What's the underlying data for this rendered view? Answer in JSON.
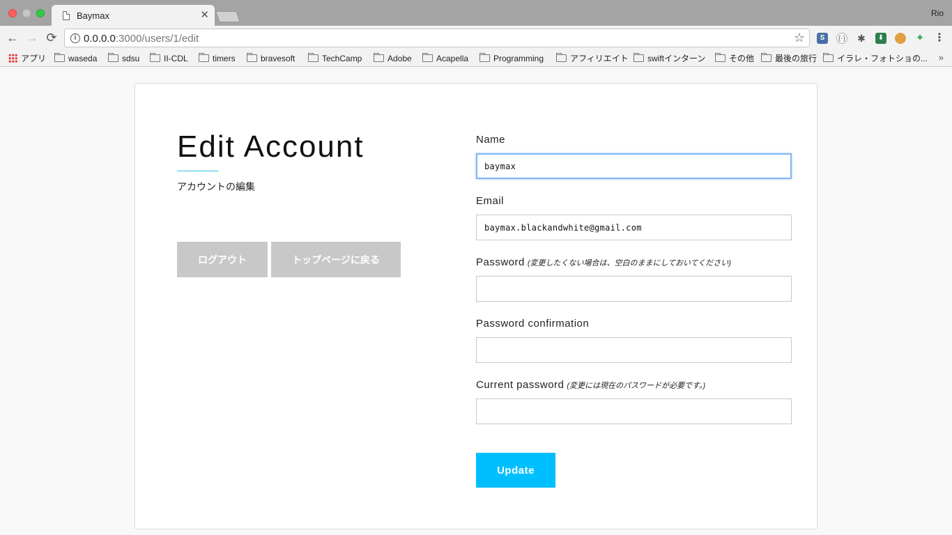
{
  "browser": {
    "tab_title": "Baymax",
    "tab_close": "✕",
    "profile_name": "Rio",
    "url_host": "0.0.0.0",
    "url_rest": ":3000/users/1/edit",
    "nav": {
      "back": "←",
      "forward": "→",
      "reload": "⟳"
    },
    "star": "☆",
    "extensions": [
      "S",
      "(·)",
      "✱",
      "⬇",
      "🍪",
      "✦",
      "⋮"
    ],
    "bookmarks": [
      "アプリ",
      "waseda",
      "sdsu",
      "II-CDL",
      "timers",
      "bravesoft",
      "TechCamp",
      "Adobe",
      "Acapella",
      "Programming",
      "アフィリエイト",
      "swiftインターン",
      "その他",
      "最後の旅行",
      "イラレ・フォトショの..."
    ],
    "bookmarks_more": "»"
  },
  "page": {
    "title": "Edit Account",
    "subtitle": "アカウントの編集",
    "logout_label": "ログアウト",
    "top_page_label": "トップページに戻る"
  },
  "form": {
    "name": {
      "label": "Name",
      "value": "baymax"
    },
    "email": {
      "label": "Email",
      "value": "baymax.blackandwhite@gmail.com"
    },
    "password": {
      "label": "Password",
      "note": "(変更したくない場合は、空白のままにしておいてください)",
      "value": ""
    },
    "password_confirmation": {
      "label": "Password confirmation",
      "value": ""
    },
    "current_password": {
      "label": "Current password",
      "note": "(変更には現在のパスワードが必要です。)",
      "value": ""
    },
    "submit_label": "Update"
  },
  "colors": {
    "accent": "#00bfff",
    "rule": "#36c5e6",
    "grey_button": "#c8c8c8",
    "focus_ring": "#7fb7f5"
  }
}
